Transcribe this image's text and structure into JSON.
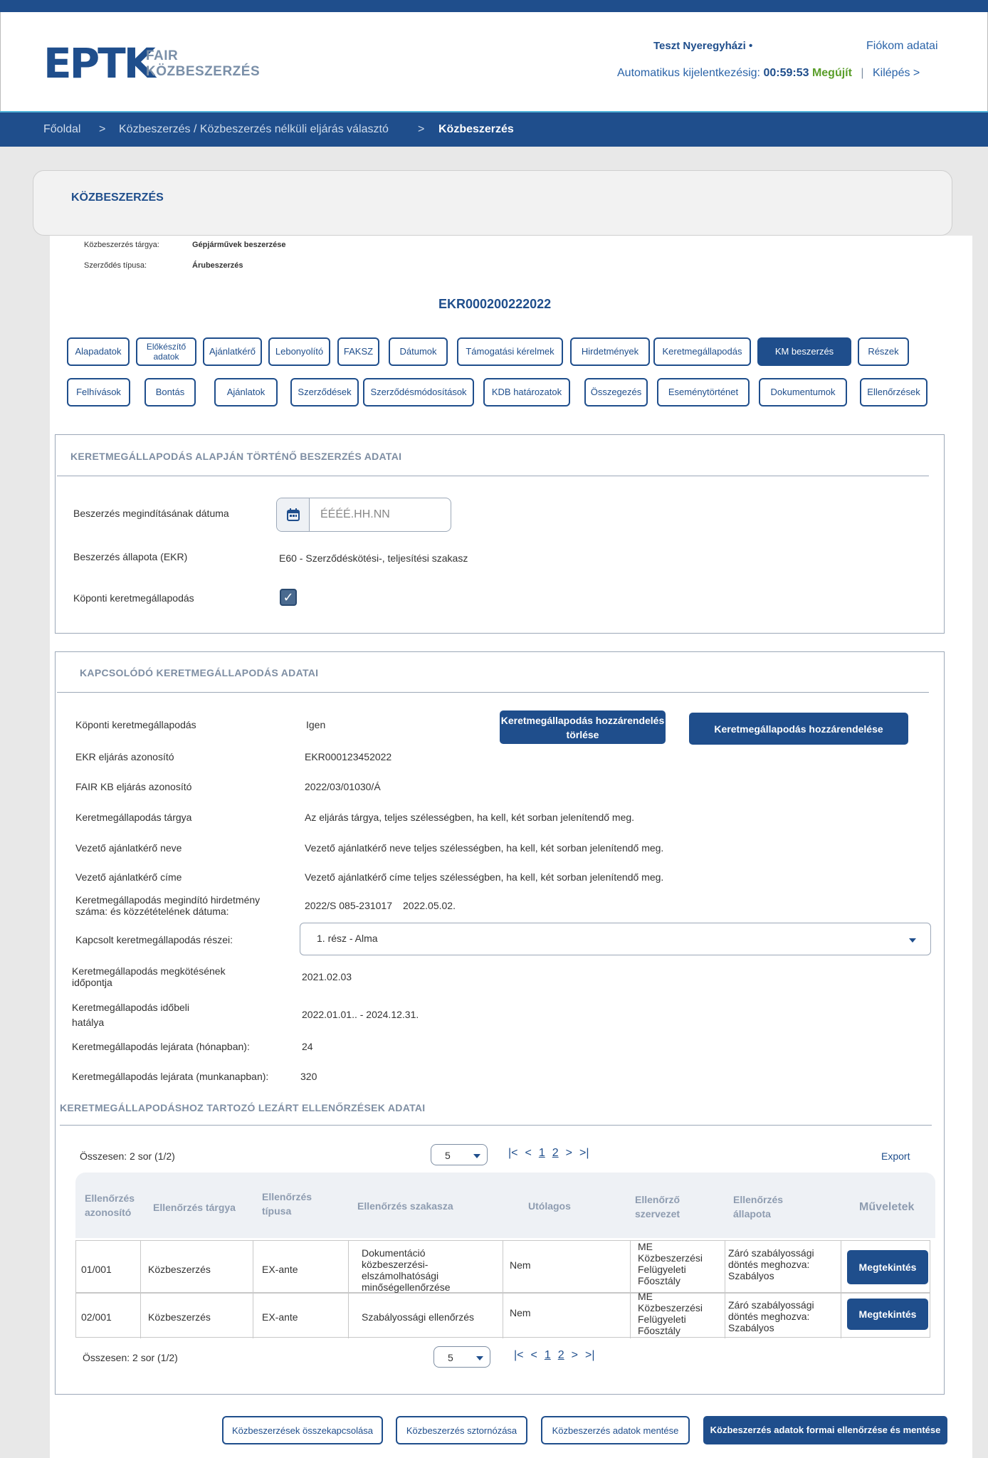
{
  "header": {
    "logo_mark": "EPTK",
    "logo_line1": "FAIR",
    "logo_line2": "KÖZBESZERZÉS",
    "user_name": "Teszt Nyeregyházi",
    "user_dot": "•",
    "account_link": "Fiókom adatai",
    "auto_logout_label": "Automatikus kijelentkezésig:",
    "auto_logout_time": "00:59:53",
    "renew_label": "Megújít",
    "separator": "|",
    "logout_label": "Kilépés >"
  },
  "breadcrumb": {
    "items": [
      "Főoldal",
      "Közbeszerzés / Közbeszerzés nélküli eljárás választó",
      "Közbeszerzés"
    ],
    "separator": ">"
  },
  "page": {
    "title": "KÖZBESZERZÉS",
    "subject_label": "Közbeszerzés tárgya:",
    "subject_value": "Gépjárművek beszerzése",
    "contract_type_label": "Szerződés típusa:",
    "contract_type_value": "Árubeszerzés",
    "ekr_id": "EKR000200222022"
  },
  "tabs_row1": [
    "Alapadatok",
    "Előkészítő adatok",
    "Ajánlatkérő",
    "Lebonyolító",
    "FAKSZ",
    "Dátumok",
    "Támogatási kérelmek",
    "Hirdetmények",
    "Keretmegállapodás",
    "KM beszerzés",
    "Részek"
  ],
  "tabs_row2": [
    "Felhívások",
    "Bontás",
    "Ajánlatok",
    "Szerződések",
    "Szerződésmódosítások",
    "KDB határozatok",
    "Összegezés",
    "Eseménytörténet",
    "Dokumentumok",
    "Ellenőrzések"
  ],
  "active_tab": "KM beszerzés",
  "section1": {
    "title": "KERETMEGÁLLAPODÁS ALAPJÁN TÖRTÉNŐ BESZERZÉS ADATAI",
    "start_date_label": "Beszerzés megindításának dátuma",
    "start_date_placeholder": "ÉÉÉÉ.HH.NN",
    "status_label": "Beszerzés állapota (EKR)",
    "status_value": "E60 - Szerződéskötési-, teljesítési szakasz",
    "central_label": "Köponti keretmegállapodás",
    "central_checked": true
  },
  "section2": {
    "title": "KAPCSOLÓDÓ KERETMEGÁLLAPODÁS ADATAI",
    "delete_button": "Keretmegállapodás hozzárendelés törlése",
    "assign_button": "Keretmegállapodás hozzárendelése",
    "rows": [
      {
        "label": "Köponti keretmegállapodás",
        "value": "Igen"
      },
      {
        "label": "EKR eljárás azonosító",
        "value": "EKR000123452022"
      },
      {
        "label": "FAIR KB  eljárás azonosító",
        "value": "2022/03/01030/Á"
      },
      {
        "label": "Keretmegállapodás tárgya",
        "value": "Az eljárás tárgya, teljes szélességben, ha kell, két sorban jelenítendő meg."
      },
      {
        "label": "Vezető ajánlatkérő neve",
        "value": "Vezető ajánlatkérő neve teljes szélességben, ha kell, két sorban jelenítendő meg."
      },
      {
        "label": "Vezető ajánlatkérő címe",
        "value": "Vezető ajánlatkérő címe teljes szélességben, ha kell, két sorban jelenítendő meg."
      }
    ],
    "notice_label_1": "Keretmegállapodás megindító hirdetmény",
    "notice_label_2": "száma: és közzétételének dátuma:",
    "notice_number": "2022/S 085-231017",
    "notice_date": "2022.05.02.",
    "parts_label": "Kapcsolt keretmegállapodás részei:",
    "parts_selected": "1. rész - Alma",
    "concluded_label_1": "Keretmegállapodás megkötésének",
    "concluded_label_2": "időpontja",
    "concluded_value": "2021.02.03",
    "validity_label_1": "Keretmegállapodás időbeli",
    "validity_label_2": "hatálya",
    "validity_value": "2022.01.01.. - 2024.12.31.",
    "expiry_months_label": "Keretmegállapodás lejárata (hónapban):",
    "expiry_months_value": "24",
    "expiry_days_label": "Keretmegállapodás lejárata (munkanapban):",
    "expiry_days_value": "320"
  },
  "checks": {
    "title": "KERETMEGÁLLAPODÁSHOZ TARTOZÓ LEZÁRT ELLENŐRZÉSEK ADATAI",
    "total": "Összesen: 2 sor (1/2)",
    "page_size": "5",
    "pager": {
      "first": "|<",
      "prev": "<",
      "p1": "1",
      "p2": "2",
      "next": ">",
      "last": ">|"
    },
    "export": "Export",
    "columns": [
      "Ellenőrzés azonosító",
      "Ellenőrzés tárgya",
      "Ellenőrzés típusa",
      "Ellenőrzés szakasza",
      "Utólagos",
      "Ellenőrző szervezet",
      "Ellenőrzés állapota",
      "Műveletek"
    ],
    "rows": [
      {
        "id": "01/001",
        "subject": "Közbeszerzés",
        "type": "EX-ante",
        "phase": "Dokumentáció közbeszerzési-elszámolhatósági minőségellenőrzése",
        "later": "Nem",
        "org": "ME Közbeszerzési Felügyeleti Főosztály",
        "status": "Záró szabályossági döntés meghozva: Szabályos",
        "action": "Megtekintés"
      },
      {
        "id": "02/001",
        "subject": "Közbeszerzés",
        "type": "EX-ante",
        "phase": "Szabályossági ellenőrzés",
        "later": "Nem",
        "org": "ME Közbeszerzési Felügyeleti Főosztály",
        "status": "Záró szabályossági döntés meghozva: Szabályos",
        "action": "Megtekintés"
      }
    ]
  },
  "footer_buttons": {
    "link": "Közbeszerzések összekapcsolása",
    "cancel": "Közbeszerzés sztornózása",
    "save": "Közbeszerzés adatok mentése",
    "check_save": "Közbeszerzés adatok formai ellenőrzése és mentése"
  },
  "colors": {
    "primary": "#1f4e8c",
    "accent_line": "#4fb3d9",
    "renew": "#5a9e2a"
  }
}
